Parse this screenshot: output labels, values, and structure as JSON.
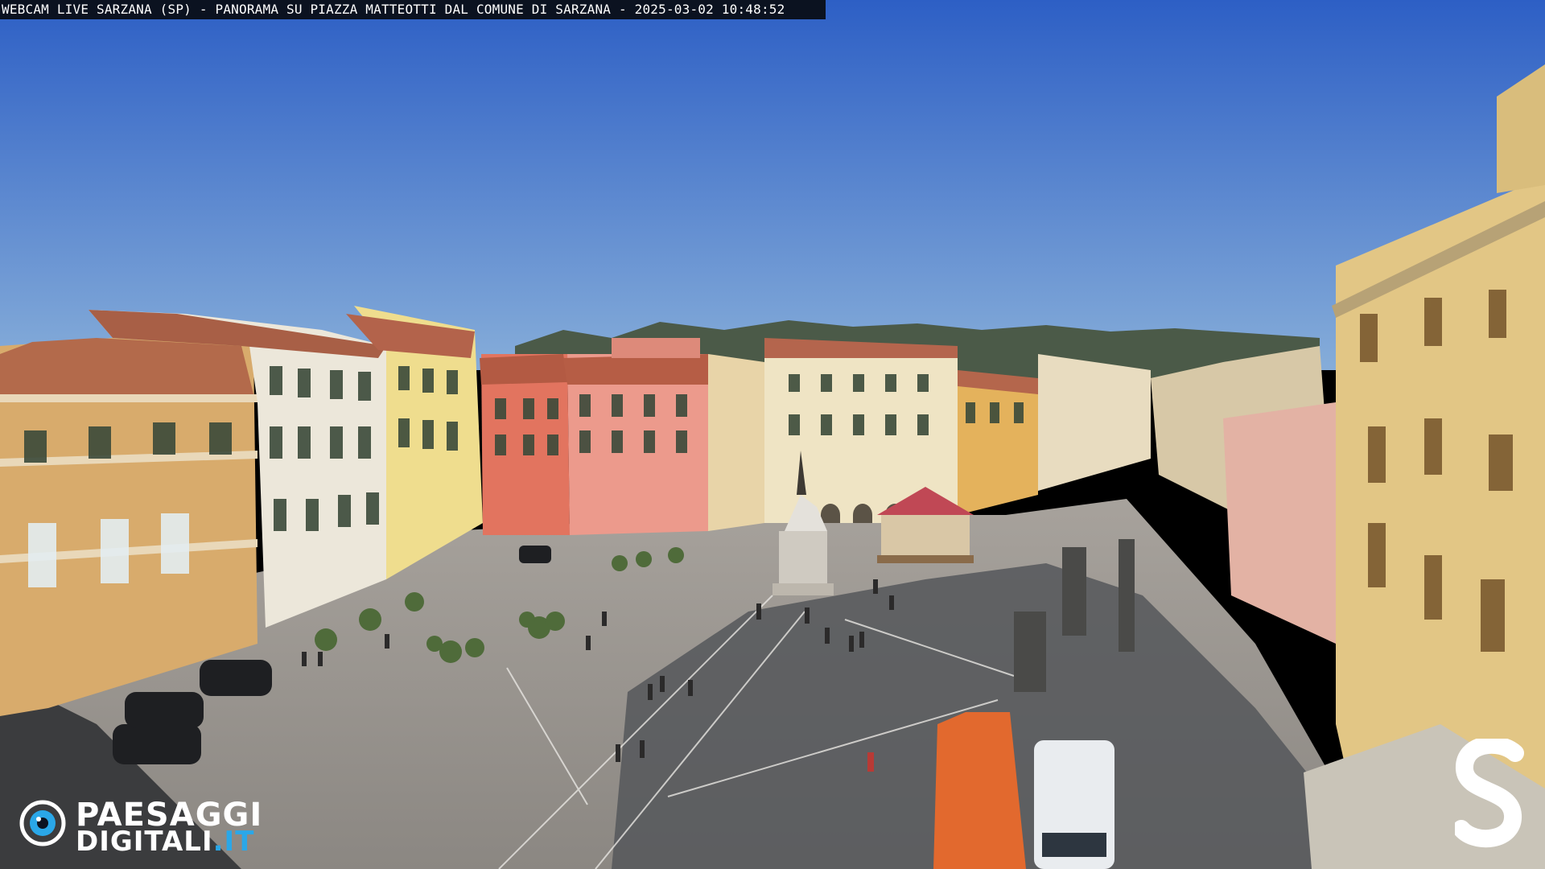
{
  "caption": {
    "text": "WEBCAM LIVE SARZANA (SP) - PANORAMA SU PIAZZA MATTEOTTI DAL COMUNE DI SARZANA - 2025-03-02  10:48:52"
  },
  "logo": {
    "line1": "PAESAGGI",
    "line2_main": "DIGITALI",
    "line2_suffix": ".IT",
    "accent": "#2aa7e8"
  },
  "colors": {
    "sky_top": "#2f62c7",
    "sky_bottom": "#7faad8",
    "pavement": "#9a958f",
    "shadow": "#3a3b3d"
  }
}
